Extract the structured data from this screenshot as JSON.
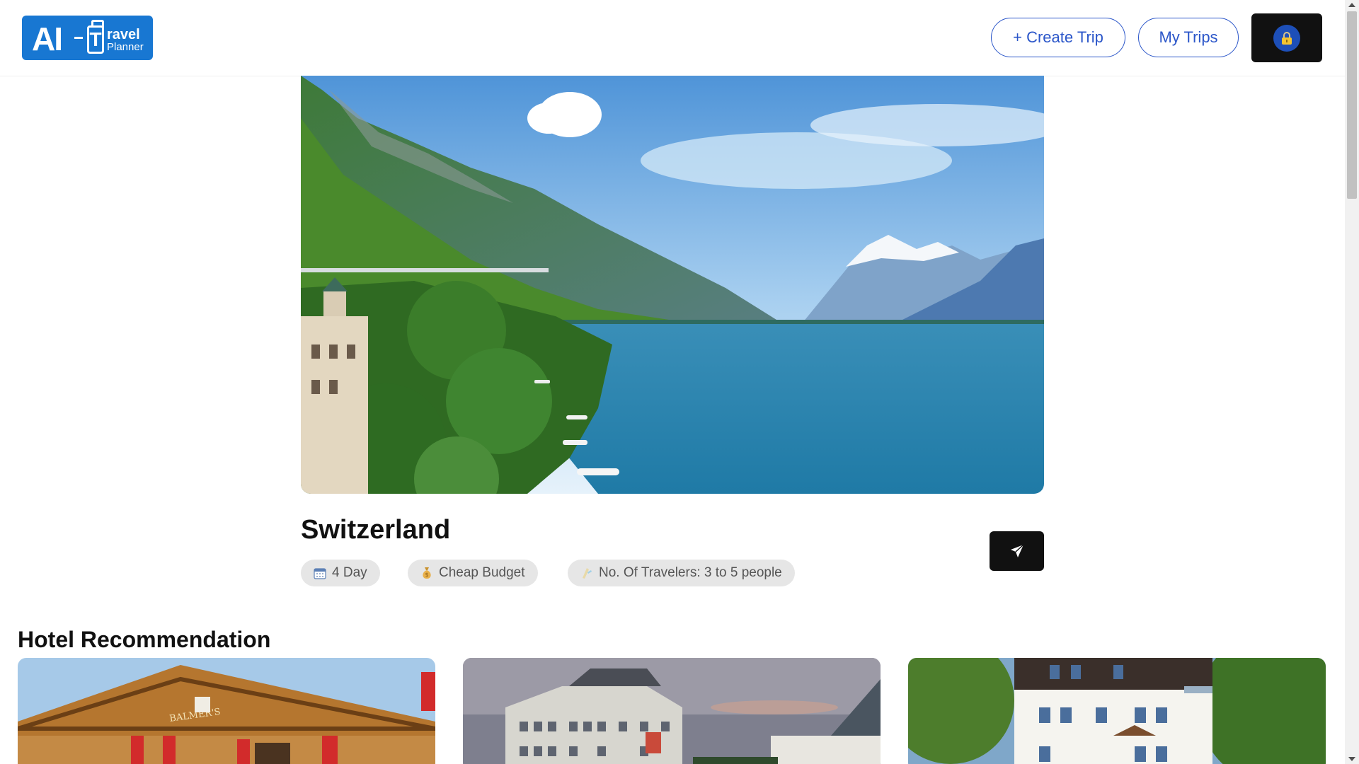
{
  "header": {
    "logo": {
      "ai": "AI",
      "word1": "ravel",
      "word2": "Planner",
      "bag_letter": "T"
    },
    "create_trip_label": "+ Create Trip",
    "my_trips_label": "My Trips",
    "account_icon": "lock-icon"
  },
  "trip": {
    "title": "Switzerland",
    "chips": [
      {
        "icon": "calendar-icon",
        "label": "4 Day"
      },
      {
        "icon": "money-bag-icon",
        "label": "Cheap Budget"
      },
      {
        "icon": "travelers-icon",
        "label": "No. Of Travelers: 3 to 5 people"
      }
    ],
    "share_icon": "send-icon"
  },
  "hotels": {
    "section_title": "Hotel Recommendation",
    "cards": [
      {
        "sign_text": "BALMER'S"
      },
      {
        "sign_text": ""
      },
      {
        "sign_text": ""
      }
    ]
  },
  "colors": {
    "accent": "#2b56c9",
    "logo_bg": "#1877d2",
    "dark_button": "#111111",
    "chip_bg": "#e6e6e6"
  }
}
